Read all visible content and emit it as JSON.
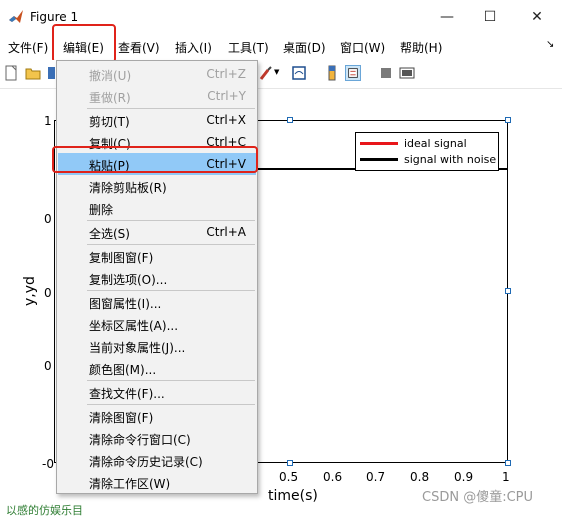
{
  "window": {
    "title": "Figure 1",
    "minimize": "—",
    "maximize": "☐",
    "close": "✕"
  },
  "menubar": {
    "items": [
      "文件(F)",
      "编辑(E)",
      "查看(V)",
      "插入(I)",
      "工具(T)",
      "桌面(D)",
      "窗口(W)",
      "帮助(H)"
    ],
    "overflow": "↘"
  },
  "edit_menu": {
    "items": [
      {
        "label": "撤消(U)",
        "shortcut": "Ctrl+Z",
        "enabled": false
      },
      {
        "label": "重做(R)",
        "shortcut": "Ctrl+Y",
        "enabled": false
      },
      {
        "label": "剪切(T)",
        "shortcut": "Ctrl+X",
        "enabled": true
      },
      {
        "label": "复制(C)",
        "shortcut": "Ctrl+C",
        "enabled": true
      },
      {
        "label": "粘贴(P)",
        "shortcut": "Ctrl+V",
        "enabled": true,
        "highlighted": true
      },
      {
        "label": "清除剪贴板(R)",
        "shortcut": "",
        "enabled": true
      },
      {
        "label": "删除",
        "shortcut": "",
        "enabled": true
      },
      {
        "label": "全选(S)",
        "shortcut": "Ctrl+A",
        "enabled": true
      },
      {
        "label": "复制图窗(F)",
        "shortcut": "",
        "enabled": true
      },
      {
        "label": "复制选项(O)...",
        "shortcut": "",
        "enabled": true
      },
      {
        "label": "图窗属性(I)...",
        "shortcut": "",
        "enabled": true
      },
      {
        "label": "坐标区属性(A)...",
        "shortcut": "",
        "enabled": true
      },
      {
        "label": "当前对象属性(J)...",
        "shortcut": "",
        "enabled": true
      },
      {
        "label": "颜色图(M)...",
        "shortcut": "",
        "enabled": true
      },
      {
        "label": "查找文件(F)...",
        "shortcut": "",
        "enabled": true
      },
      {
        "label": "清除图窗(F)",
        "shortcut": "",
        "enabled": true
      },
      {
        "label": "清除命令行窗口(C)",
        "shortcut": "",
        "enabled": true
      },
      {
        "label": "清除命令历史记录(C)",
        "shortcut": "",
        "enabled": true
      },
      {
        "label": "清除工作区(W)",
        "shortcut": "",
        "enabled": true
      }
    ]
  },
  "plot": {
    "xlabel": "time(s)",
    "ylabel": "y,yd",
    "xticks": [
      "0.5",
      "0.6",
      "0.7",
      "0.8",
      "0.9",
      "1"
    ],
    "yticks": [
      "1",
      "0",
      "0",
      "0",
      "-0"
    ],
    "legend": [
      {
        "name": "ideal signal",
        "color": "#e8161a"
      },
      {
        "name": "signal with noise",
        "color": "#000000"
      }
    ]
  },
  "watermark": "CSDN @傻童:CPU",
  "bottom_text": "以感的仿娱乐目",
  "colors": {
    "highlight": "#91c9f7",
    "menu_active": "#cce4f7",
    "annotation_red": "#e0231a",
    "handle": "#1f6ab4"
  }
}
